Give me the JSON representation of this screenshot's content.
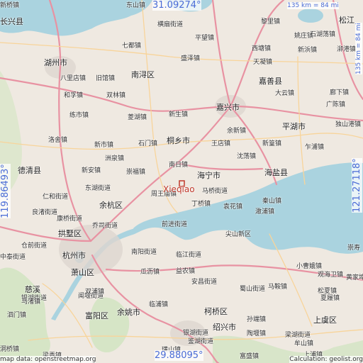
{
  "map": {
    "marker_label": "Xieqiao",
    "coords": {
      "top": "31.09274°",
      "bottom": "29.88095°",
      "left": "119.86493°",
      "right": "121.27118°"
    },
    "scale": {
      "top": "135 km = 84 mi",
      "right": "135 km = 84 mi"
    },
    "footer": {
      "left": "map data: openstreetmap.org",
      "right": "Calculation: geolist.org"
    },
    "places": [
      {
        "name": "长兴县",
        "city": true
      },
      {
        "name": "东山镇",
        "city": false
      },
      {
        "name": "横扇街道",
        "city": false
      },
      {
        "name": "七都镇",
        "city": false
      },
      {
        "name": "平望镇",
        "city": false
      },
      {
        "name": "黎里镇",
        "city": false
      },
      {
        "name": "盛泽镇",
        "city": false
      },
      {
        "name": "湖州市",
        "city": true
      },
      {
        "name": "南浔区",
        "city": true
      },
      {
        "name": "八里店镇",
        "city": false
      },
      {
        "name": "旧馆镇",
        "city": false
      },
      {
        "name": "和孚镇",
        "city": false
      },
      {
        "name": "双林镇",
        "city": false
      },
      {
        "name": "练市镇",
        "city": false
      },
      {
        "name": "菱湖镇",
        "city": false
      },
      {
        "name": "新生镇",
        "city": false
      },
      {
        "name": "嘉兴市",
        "city": true
      },
      {
        "name": "天凝镇",
        "city": false
      },
      {
        "name": "西塘镇",
        "city": false
      },
      {
        "name": "嘉善县",
        "city": true
      },
      {
        "name": "大云镇",
        "city": false
      },
      {
        "name": "姚庄镇",
        "city": false
      },
      {
        "name": "石湖荡镇",
        "city": false
      },
      {
        "name": "新浜镇",
        "city": false
      },
      {
        "name": "松江",
        "city": true
      },
      {
        "name": "泖港镇",
        "city": false
      },
      {
        "name": "廊下镇",
        "city": false
      },
      {
        "name": "广陈镇",
        "city": false
      },
      {
        "name": "平湖市",
        "city": true
      },
      {
        "name": "独山港镇",
        "city": false
      },
      {
        "name": "洛舍镇",
        "city": false
      },
      {
        "name": "桐乡市",
        "city": true
      },
      {
        "name": "余新镇",
        "city": false
      },
      {
        "name": "新市镇",
        "city": false
      },
      {
        "name": "石门镇",
        "city": false
      },
      {
        "name": "王店镇",
        "city": false
      },
      {
        "name": "新篁镇",
        "city": false
      },
      {
        "name": "乍浦镇",
        "city": false
      },
      {
        "name": "德清县",
        "city": true
      },
      {
        "name": "洲泉镇",
        "city": false
      },
      {
        "name": "沈荡镇",
        "city": false
      },
      {
        "name": "南日镇",
        "city": false
      },
      {
        "name": "新安镇",
        "city": false
      },
      {
        "name": "崇福镇",
        "city": false
      },
      {
        "name": "海宁市",
        "city": true
      },
      {
        "name": "海盐县",
        "city": true
      },
      {
        "name": "东湖街道",
        "city": false
      },
      {
        "name": "周王庙镇",
        "city": false
      },
      {
        "name": "马桥街道",
        "city": false
      },
      {
        "name": "仁和街道",
        "city": false
      },
      {
        "name": "丁桥镇",
        "city": false
      },
      {
        "name": "袁花镇",
        "city": false
      },
      {
        "name": "秦山镇",
        "city": false
      },
      {
        "name": "余杭区",
        "city": true
      },
      {
        "name": "良渚街道",
        "city": false
      },
      {
        "name": "澉浦镇",
        "city": false
      },
      {
        "name": "康桥街道",
        "city": false
      },
      {
        "name": "乔司街道",
        "city": false
      },
      {
        "name": "拱墅区",
        "city": true
      },
      {
        "name": "前进街道",
        "city": false
      },
      {
        "name": "尖山新区",
        "city": false
      },
      {
        "name": "仓前街道",
        "city": false
      },
      {
        "name": "中泰街道",
        "city": false
      },
      {
        "name": "杭州市",
        "city": true
      },
      {
        "name": "南阳街道",
        "city": false
      },
      {
        "name": "临江街道",
        "city": false
      },
      {
        "name": "崇寿",
        "city": false
      },
      {
        "name": "萧山区",
        "city": true
      },
      {
        "name": "瓜沥镇",
        "city": false
      },
      {
        "name": "益农镇",
        "city": false
      },
      {
        "name": "小曹娥镇",
        "city": false
      },
      {
        "name": "观海卫镇",
        "city": false
      },
      {
        "name": "银湖街道",
        "city": false
      },
      {
        "name": "闻堰街道",
        "city": false
      },
      {
        "name": "安昌街道",
        "city": false
      },
      {
        "name": "马鞍镇",
        "city": false
      },
      {
        "name": "黄家埠镇",
        "city": false
      },
      {
        "name": "慈溪",
        "city": true
      },
      {
        "name": "双浦镇",
        "city": false
      },
      {
        "name": "蜀山街道",
        "city": false
      },
      {
        "name": "松夏镇",
        "city": false
      },
      {
        "name": "泗门镇",
        "city": false
      },
      {
        "name": "富阳区",
        "city": true
      },
      {
        "name": "临浦镇",
        "city": false
      },
      {
        "name": "柯桥区",
        "city": true
      },
      {
        "name": "孙端镇",
        "city": false
      },
      {
        "name": "上虞区",
        "city": true
      },
      {
        "name": "余姚市",
        "city": true
      },
      {
        "name": "夏履镇",
        "city": false
      },
      {
        "name": "马渚镇",
        "city": false
      },
      {
        "name": "银湖街道",
        "city": false
      },
      {
        "name": "绍兴市",
        "city": true
      },
      {
        "name": "陶堰镇",
        "city": false
      },
      {
        "name": "梁湖街道",
        "city": false
      },
      {
        "name": "牟山镇",
        "city": false
      },
      {
        "name": "璜山镇",
        "city": false
      },
      {
        "name": "鉴湖街道",
        "city": false
      },
      {
        "name": "富盛镇",
        "city": false
      },
      {
        "name": "上浦镇",
        "city": false
      },
      {
        "name": "梁弄镇",
        "city": false
      },
      {
        "name": "洞桥镇",
        "city": false
      },
      {
        "name": "新桥镇",
        "city": false
      }
    ]
  }
}
